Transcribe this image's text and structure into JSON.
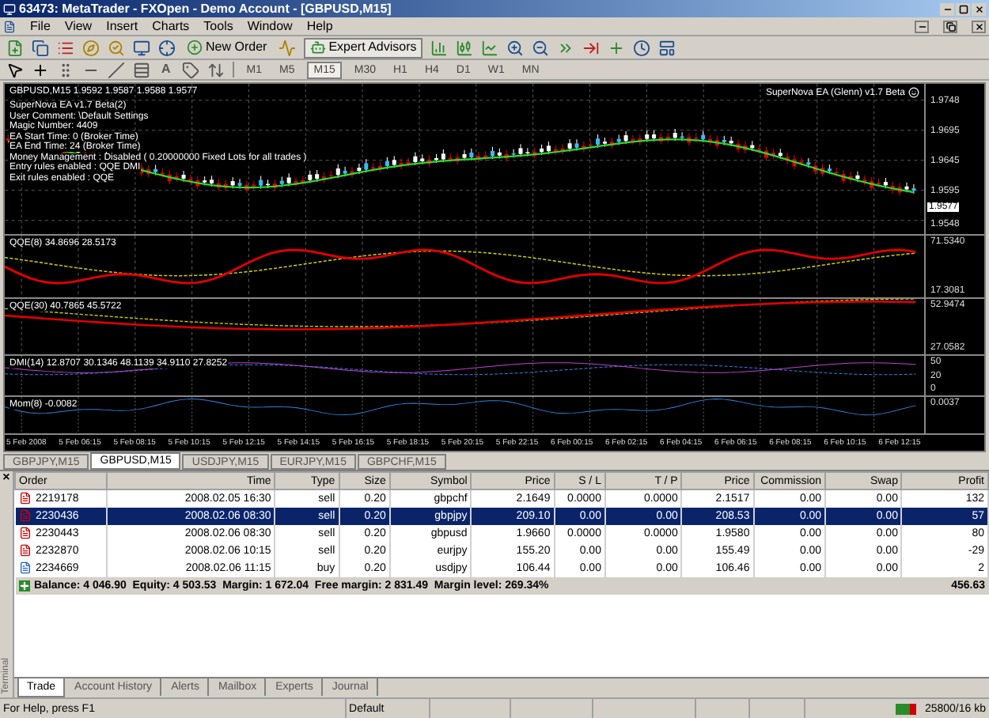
{
  "window": {
    "title": "63473: MetaTrader - FXOpen - Demo Account - [GBPUSD,M15]"
  },
  "menu": [
    "File",
    "View",
    "Insert",
    "Charts",
    "Tools",
    "Window",
    "Help"
  ],
  "toolbar": {
    "new_order": "New Order",
    "expert_advisors": "Expert Advisors",
    "text_tool": "A"
  },
  "timeframes": [
    {
      "label": "M1",
      "selected": false
    },
    {
      "label": "M5",
      "selected": false
    },
    {
      "label": "M15",
      "selected": true
    },
    {
      "label": "M30",
      "selected": false
    },
    {
      "label": "H1",
      "selected": false
    },
    {
      "label": "H4",
      "selected": false
    },
    {
      "label": "D1",
      "selected": false
    },
    {
      "label": "W1",
      "selected": false
    },
    {
      "label": "MN",
      "selected": false
    }
  ],
  "chart": {
    "header": "GBPUSD,M15  1.9592 1.9587 1.9588 1.9577",
    "ea_name": "SuperNova EA (Glenn) v1.7 Beta",
    "comments": [
      "SuperNova EA v1.7 Beta(2)",
      "User Comment: \\Default Settings",
      "Magic Number: 4409",
      "EA Start Time: 0 (Broker Time)",
      "EA End Time: 24 (Broker Time)",
      "Money Management : Disabled ( 0.20000000 Fixed Lots for all trades )",
      "Entry rules enabled : QQE DMI",
      "Exit rules enabled : QQE"
    ],
    "price_ticks": [
      "1.9748",
      "1.9695",
      "1.9645",
      "1.9595",
      "1.9548"
    ],
    "current_price": "1.9577",
    "indicators": [
      {
        "kind": "qqe",
        "label": "QQE(8) 34.8696 28.5173",
        "ticks": [
          "71.5340",
          "17.3081"
        ]
      },
      {
        "kind": "qqe_slow",
        "label": "QQE(30) 40.7865 45.5722",
        "ticks": [
          "52.9474",
          "27.0582"
        ]
      },
      {
        "kind": "dmi",
        "label": "DMI(14) 12.8707 30.1346 48.1139 34.9110 27.8252",
        "ticks": [
          "50",
          "20",
          "0"
        ]
      },
      {
        "kind": "momentum",
        "label": "Mom(8) -0.0082",
        "ticks": [
          "0.0037"
        ]
      }
    ],
    "time_labels": [
      "5 Feb 2008",
      "5 Feb 06:15",
      "5 Feb 08:15",
      "5 Feb 10:15",
      "5 Feb 12:15",
      "5 Feb 14:15",
      "5 Feb 16:15",
      "5 Feb 18:15",
      "5 Feb 20:15",
      "5 Feb 22:15",
      "6 Feb 00:15",
      "6 Feb 02:15",
      "6 Feb 04:15",
      "6 Feb 06:15",
      "6 Feb 08:15",
      "6 Feb 10:15",
      "6 Feb 12:15"
    ]
  },
  "chart_tabs": [
    {
      "label": "GBPJPY,M15",
      "selected": false
    },
    {
      "label": "GBPUSD,M15",
      "selected": true
    },
    {
      "label": "USDJPY,M15",
      "selected": false
    },
    {
      "label": "EURJPY,M15",
      "selected": false
    },
    {
      "label": "GBPCHF,M15",
      "selected": false
    }
  ],
  "terminal": {
    "close_glyph": "×",
    "side_label": "Terminal",
    "columns": [
      "Order",
      "Time",
      "Type",
      "Size",
      "Symbol",
      "Price",
      "S / L",
      "T / P",
      "Price",
      "Commission",
      "Swap",
      "Profit"
    ],
    "rows": [
      {
        "kind": "sell",
        "selected": false,
        "cells": [
          "2219178",
          "2008.02.05 16:30",
          "sell",
          "0.20",
          "gbpchf",
          "2.1649",
          "0.0000",
          "0.0000",
          "2.1517",
          "0.00",
          "0.00",
          "132"
        ]
      },
      {
        "kind": "sell",
        "selected": true,
        "cells": [
          "2230436",
          "2008.02.06 08:30",
          "sell",
          "0.20",
          "gbpjpy",
          "209.10",
          "0.00",
          "0.00",
          "208.53",
          "0.00",
          "0.00",
          "57"
        ]
      },
      {
        "kind": "sell",
        "selected": false,
        "cells": [
          "2230443",
          "2008.02.06 08:30",
          "sell",
          "0.20",
          "gbpusd",
          "1.9660",
          "0.0000",
          "0.0000",
          "1.9580",
          "0.00",
          "0.00",
          "80"
        ]
      },
      {
        "kind": "sell",
        "selected": false,
        "cells": [
          "2232870",
          "2008.02.06 10:15",
          "sell",
          "0.20",
          "eurjpy",
          "155.20",
          "0.00",
          "0.00",
          "155.49",
          "0.00",
          "0.00",
          "-29"
        ]
      },
      {
        "kind": "buy",
        "selected": false,
        "cells": [
          "2234669",
          "2008.02.06 11:15",
          "buy",
          "0.20",
          "usdjpy",
          "106.44",
          "0.00",
          "0.00",
          "106.46",
          "0.00",
          "0.00",
          "2"
        ]
      }
    ],
    "summary": "Balance: 4 046.90  Equity: 4 503.53  Margin: 1 672.04  Free margin: 2 831.49  Margin level: 269.34%",
    "total_profit": "456.63",
    "tabs": [
      {
        "label": "Trade",
        "selected": true
      },
      {
        "label": "Account History",
        "selected": false
      },
      {
        "label": "Alerts",
        "selected": false
      },
      {
        "label": "Mailbox",
        "selected": false
      },
      {
        "label": "Experts",
        "selected": false
      },
      {
        "label": "Journal",
        "selected": false
      }
    ]
  },
  "status_bar": {
    "help": "For Help, press F1",
    "profile": "Default",
    "traffic": "25800/16 kb"
  }
}
